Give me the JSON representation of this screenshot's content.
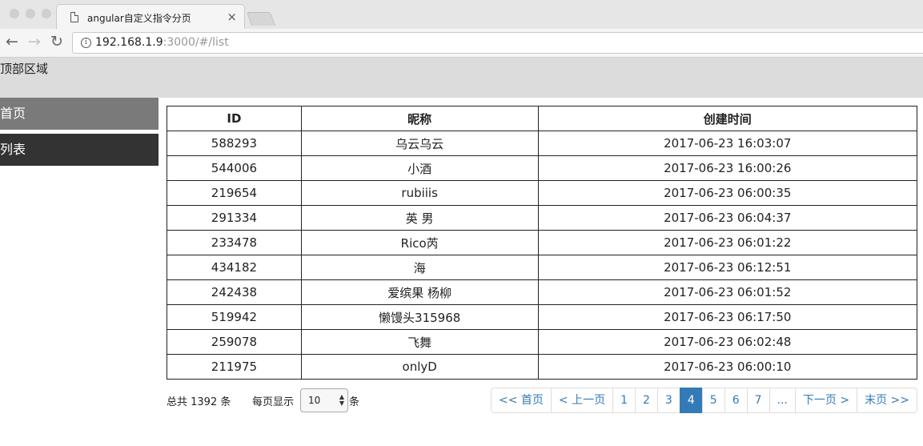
{
  "browser": {
    "tab_title": "angular自定义指令分页",
    "tab_close": "×",
    "url_host": "192.168.1.9",
    "url_rest": ":3000/#/list",
    "back_icon": "←",
    "forward_icon": "→",
    "reload_icon": "↻",
    "info_icon": "i"
  },
  "header": {
    "title": "顶部区域"
  },
  "sidebar": {
    "items": [
      {
        "label": "首页"
      },
      {
        "label": "列表"
      }
    ]
  },
  "table": {
    "columns": [
      "ID",
      "昵称",
      "创建时间"
    ],
    "rows": [
      [
        "588293",
        "乌云乌云",
        "2017-06-23 16:03:07"
      ],
      [
        "544006",
        "小酒",
        "2017-06-23 16:00:26"
      ],
      [
        "219654",
        "rubiiis",
        "2017-06-23 06:00:35"
      ],
      [
        "291334",
        "英 男",
        "2017-06-23 06:04:37"
      ],
      [
        "233478",
        "Rico芮",
        "2017-06-23 06:01:22"
      ],
      [
        "434182",
        "海",
        "2017-06-23 06:12:51"
      ],
      [
        "242438",
        "爱缤果 杨柳",
        "2017-06-23 06:01:52"
      ],
      [
        "519942",
        "懒馒头315968",
        "2017-06-23 06:17:50"
      ],
      [
        "259078",
        "飞舞",
        "2017-06-23 06:02:48"
      ],
      [
        "211975",
        "onlyD",
        "2017-06-23 06:00:10"
      ]
    ]
  },
  "footer": {
    "total_text": "总共 1392 条",
    "per_page_label": "每页显示",
    "page_size": "10",
    "unit": "条"
  },
  "pagination": {
    "first": "<< 首页",
    "prev": "< 上一页",
    "pages": [
      "1",
      "2",
      "3",
      "4",
      "5",
      "6",
      "7",
      "..."
    ],
    "active": "4",
    "next": "下一页 >",
    "last": "末页 >>"
  },
  "colors": {
    "active_page": "#337ab7",
    "sidebar_active": "#7a7a7a",
    "sidebar_dark": "#333333",
    "header_bg": "#dcdcdc"
  }
}
